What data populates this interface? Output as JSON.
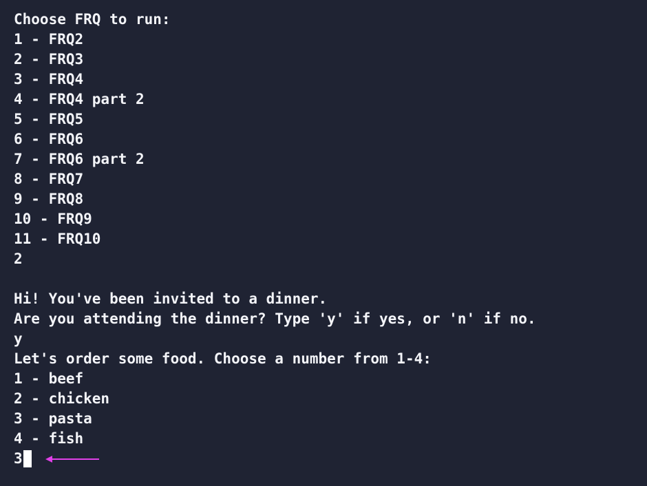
{
  "terminal": {
    "lines": [
      "Choose FRQ to run:",
      "1 - FRQ2",
      "2 - FRQ3",
      "3 - FRQ4",
      "4 - FRQ4 part 2",
      "5 - FRQ5",
      "6 - FRQ6",
      "7 - FRQ6 part 2",
      "8 - FRQ7",
      "9 - FRQ8",
      "10 - FRQ9",
      "11 - FRQ10",
      "2",
      "",
      "Hi! You've been invited to a dinner.",
      "Are you attending the dinner? Type 'y' if yes, or 'n' if no.",
      "y",
      "Let's order some food. Choose a number from 1-4:",
      "1 - beef",
      "2 - chicken",
      "3 - pasta",
      "4 - fish"
    ],
    "current_input": "3",
    "colors": {
      "background": "#1f2333",
      "text": "#f3f4f8",
      "cursor": "#ffffff",
      "arrow": "#e040e8"
    },
    "arrow_icon": "left-arrow-icon"
  }
}
